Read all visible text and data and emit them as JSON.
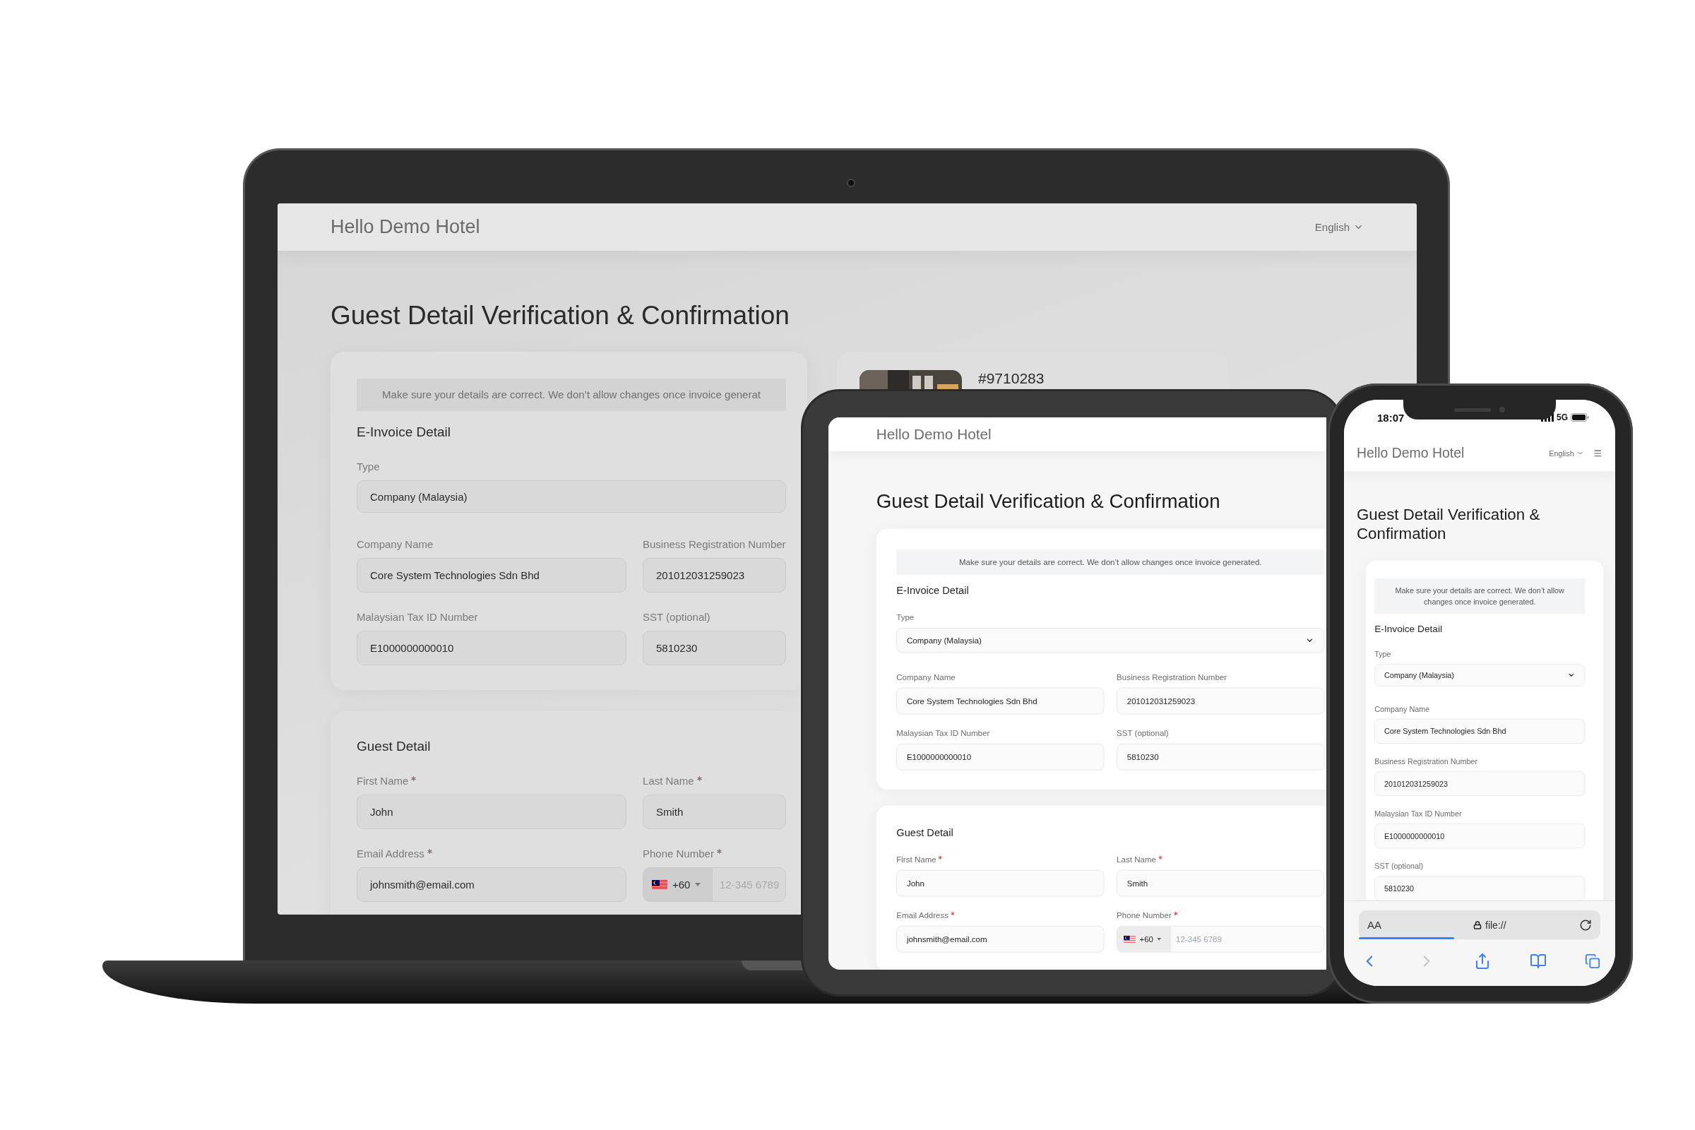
{
  "laptop": {
    "header": {
      "brand": "Hello Demo Hotel",
      "language": "English"
    },
    "title": "Guest Detail Verification & Confirmation",
    "notice": "Make sure your details are correct. We don’t allow changes once invoice generat",
    "einvoice": {
      "title": "E-Invoice Detail",
      "fields": [
        {
          "kind": "select",
          "label": "Type",
          "required": false,
          "value": "Company (Malaysia)"
        },
        {
          "kind": "input",
          "label": "Company Name",
          "required": false,
          "value": "Core System Technologies Sdn Bhd"
        },
        {
          "kind": "input",
          "label": "Business Registration Number",
          "required": false,
          "value": "201012031259023"
        },
        {
          "kind": "input",
          "label": "Malaysian Tax ID Number",
          "required": false,
          "value": "E1000000000010"
        },
        {
          "kind": "input",
          "label": "SST (optional)",
          "required": false,
          "value": "5810230"
        }
      ]
    },
    "guest": {
      "title": "Guest Detail",
      "fields": [
        {
          "kind": "input",
          "label": "First Name",
          "required": true,
          "value": "John"
        },
        {
          "kind": "input",
          "label": "Last Name",
          "required": true,
          "value": "Smith"
        },
        {
          "kind": "input",
          "label": "Email Address",
          "required": true,
          "value": "johnsmith@email.com"
        },
        {
          "kind": "phone",
          "label": "Phone Number",
          "required": true,
          "code": "+60",
          "placeholder": "12-345 6789"
        }
      ]
    },
    "booking": {
      "number": "#9710283"
    }
  },
  "tablet": {
    "header": {
      "brand": "Hello Demo Hotel"
    },
    "title": "Guest Detail Verification & Confirmation",
    "notice": "Make sure your details are correct. We don’t allow changes once invoice generated.",
    "einvoice": {
      "title": "E-Invoice Detail",
      "fields": [
        {
          "kind": "select",
          "label": "Type",
          "required": false,
          "value": "Company (Malaysia)"
        },
        {
          "kind": "input",
          "label": "Company Name",
          "required": false,
          "value": "Core System Technologies Sdn Bhd"
        },
        {
          "kind": "input",
          "label": "Business Registration Number",
          "required": false,
          "value": "201012031259023"
        },
        {
          "kind": "input",
          "label": "Malaysian Tax ID Number",
          "required": false,
          "value": "E1000000000010"
        },
        {
          "kind": "input",
          "label": "SST (optional)",
          "required": false,
          "value": "5810230"
        }
      ]
    },
    "guest": {
      "title": "Guest Detail",
      "fields": [
        {
          "kind": "input",
          "label": "First Name",
          "required": true,
          "value": "John"
        },
        {
          "kind": "input",
          "label": "Last Name",
          "required": true,
          "value": "Smith"
        },
        {
          "kind": "input",
          "label": "Email Address",
          "required": true,
          "value": "johnsmith@email.com"
        },
        {
          "kind": "phone",
          "label": "Phone Number",
          "required": true,
          "code": "+60",
          "placeholder": "12-345 6789"
        }
      ]
    }
  },
  "phone": {
    "status": {
      "time": "18:07",
      "network": "5G"
    },
    "header": {
      "brand": "Hello Demo Hotel",
      "language": "English"
    },
    "title": "Guest Detail Verification & Confirmation",
    "notice": "Make sure your details are correct. We don’t allow changes once invoice generated.",
    "einvoice": {
      "title": "E-Invoice Detail",
      "fields": [
        {
          "kind": "select",
          "label": "Type",
          "required": false,
          "value": "Company (Malaysia)"
        },
        {
          "kind": "input",
          "label": "Company Name",
          "required": false,
          "value": "Core System Technologies Sdn Bhd"
        },
        {
          "kind": "input",
          "label": "Business Registration Number",
          "required": false,
          "value": "201012031259023"
        },
        {
          "kind": "input",
          "label": "Malaysian Tax ID Number",
          "required": false,
          "value": "E1000000000010"
        },
        {
          "kind": "input",
          "label": "SST (optional)",
          "required": false,
          "value": "5810230"
        }
      ]
    },
    "browser": {
      "text_size": "AA",
      "address": "file://"
    }
  }
}
